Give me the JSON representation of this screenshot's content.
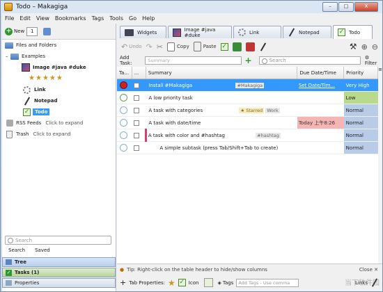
{
  "window": {
    "title": "Todo – Makagiga",
    "buttons": [
      "–",
      "□",
      "X"
    ]
  },
  "menu": [
    "File",
    "Edit",
    "View",
    "Bookmarks",
    "Tags",
    "Tools",
    "Go",
    "Help"
  ],
  "left": {
    "new_label": "New",
    "new_count": "1",
    "tree": {
      "root": "Files and Folders",
      "examples": "Examples",
      "image": "Image #java #duke",
      "link": "Link",
      "notepad": "Notepad",
      "todo": "Todo",
      "rss": "RSS Feeds",
      "rss_hint": "Click to expand",
      "trash": "Trash",
      "trash_hint": "Click to expand"
    },
    "search_placeholder": "Search",
    "search_tab": "Search",
    "saved_tab": "Saved",
    "accordion": {
      "tree": "Tree",
      "tasks": "Tasks (1)",
      "properties": "Properties"
    }
  },
  "tabs": [
    "Widgets",
    "Image #java #duke",
    "Link",
    "Notepad",
    "Todo"
  ],
  "toolbar": {
    "undo": "Undo",
    "copy": "Copy",
    "paste": "Paste"
  },
  "filter": {
    "add_task_label": "Add Task:",
    "add_task_placeholder": "Summary",
    "search_placeholder": "Search",
    "filter_label": "Filter"
  },
  "table": {
    "headers": [
      "Ta...",
      "...",
      "Summary",
      "Due Date/Time",
      "Priority"
    ],
    "rows": [
      {
        "summary": "Install #Makagiga",
        "tags": "#Makagiga",
        "due": "Set Date/Tim...",
        "priority": "Very High"
      },
      {
        "summary": "A low priority task",
        "tags": "",
        "due": "",
        "priority": "Low"
      },
      {
        "summary": "A task with categories",
        "starred": "Starred",
        "tags": "Work",
        "due": "",
        "priority": "Normal"
      },
      {
        "summary": "A task with date/time",
        "tags": "",
        "due": "Today 上午8:26",
        "priority": "Normal"
      },
      {
        "summary": "A task with color and #hashtag",
        "tags": "#hashtag",
        "due": "",
        "priority": "Normal"
      },
      {
        "summary": "A simple subtask (press Tab/Shift+Tab to create)",
        "tags": "",
        "due": "",
        "priority": "Normal"
      }
    ]
  },
  "tip": {
    "text": "Tip: Right-click on the table header to hide/show columns",
    "close": "Close"
  },
  "props": {
    "label": "Tab Properties:",
    "icon": "Icon",
    "tags_label": "Tags",
    "tags_placeholder": "Add Tags - Use comma",
    "links": "Links"
  },
  "watermark": "当下软件园"
}
